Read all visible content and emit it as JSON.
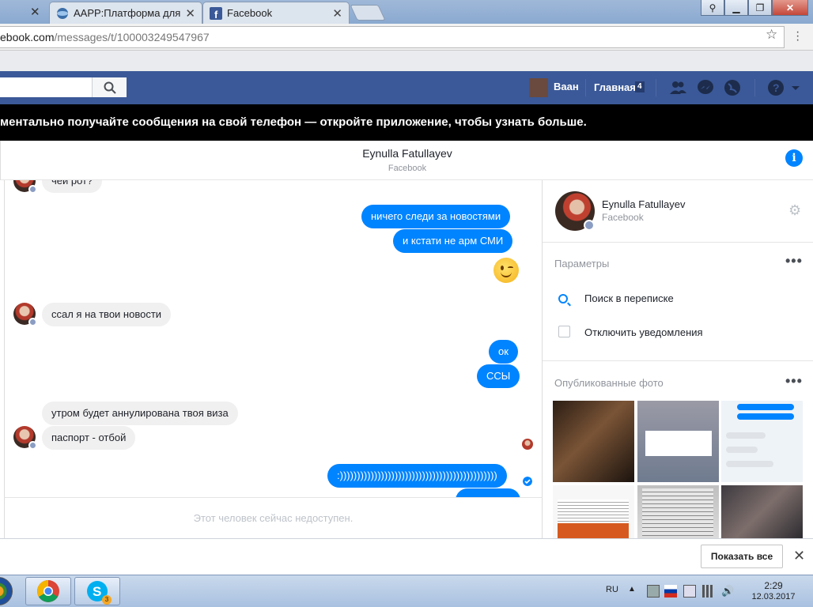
{
  "browser": {
    "tabs": [
      {
        "label": "AAPP:Платформа для м",
        "active": false
      },
      {
        "label": "Facebook",
        "active": false
      }
    ],
    "url_host": "ebook.com",
    "url_path": "/messages/t/100003249547967",
    "window_buttons": [
      "min",
      "restore",
      "close"
    ]
  },
  "fb": {
    "user_name": "Ваан",
    "home_label": "Главная",
    "home_count": "4"
  },
  "notice": "ментально получайте сообщения на свой телефон — откройте приложение, чтобы узнать больше.",
  "thread": {
    "name": "Eynulla Fatullayev",
    "sub": "Facebook"
  },
  "messages": [
    {
      "dir": "in",
      "text": "чей рот?"
    },
    {
      "dir": "out",
      "text": "ничего следи за новостями"
    },
    {
      "dir": "out",
      "text": "и кстати не арм СМИ"
    },
    {
      "dir": "in",
      "text": "ссал я на твои новости"
    },
    {
      "dir": "out",
      "text": "ок"
    },
    {
      "dir": "out",
      "text": "ССЫ"
    },
    {
      "dir": "in",
      "text": "утром будет аннулирована твоя виза"
    },
    {
      "dir": "in",
      "text": "паспорт - отбой"
    },
    {
      "dir": "out",
      "text": ":))))))))))))))))))))))))))))))))))))))))))))))"
    }
  ],
  "unavailable": "Этот человек сейчас недоступен.",
  "panel": {
    "name": "Eynulla Fatullayev",
    "sub": "Facebook",
    "options_header": "Параметры",
    "search_label": "Поиск в переписке",
    "mute_label": "Отключить уведомления",
    "photos_header": "Опубликованные фото"
  },
  "bottom": {
    "show_all": "Показать все"
  },
  "taskbar": {
    "lang": "RU",
    "time": "2:29",
    "date": "12.03.2017",
    "skype_badge": "3"
  },
  "colors": {
    "fb_blue": "#3b5998",
    "messenger_blue": "#0084ff"
  }
}
